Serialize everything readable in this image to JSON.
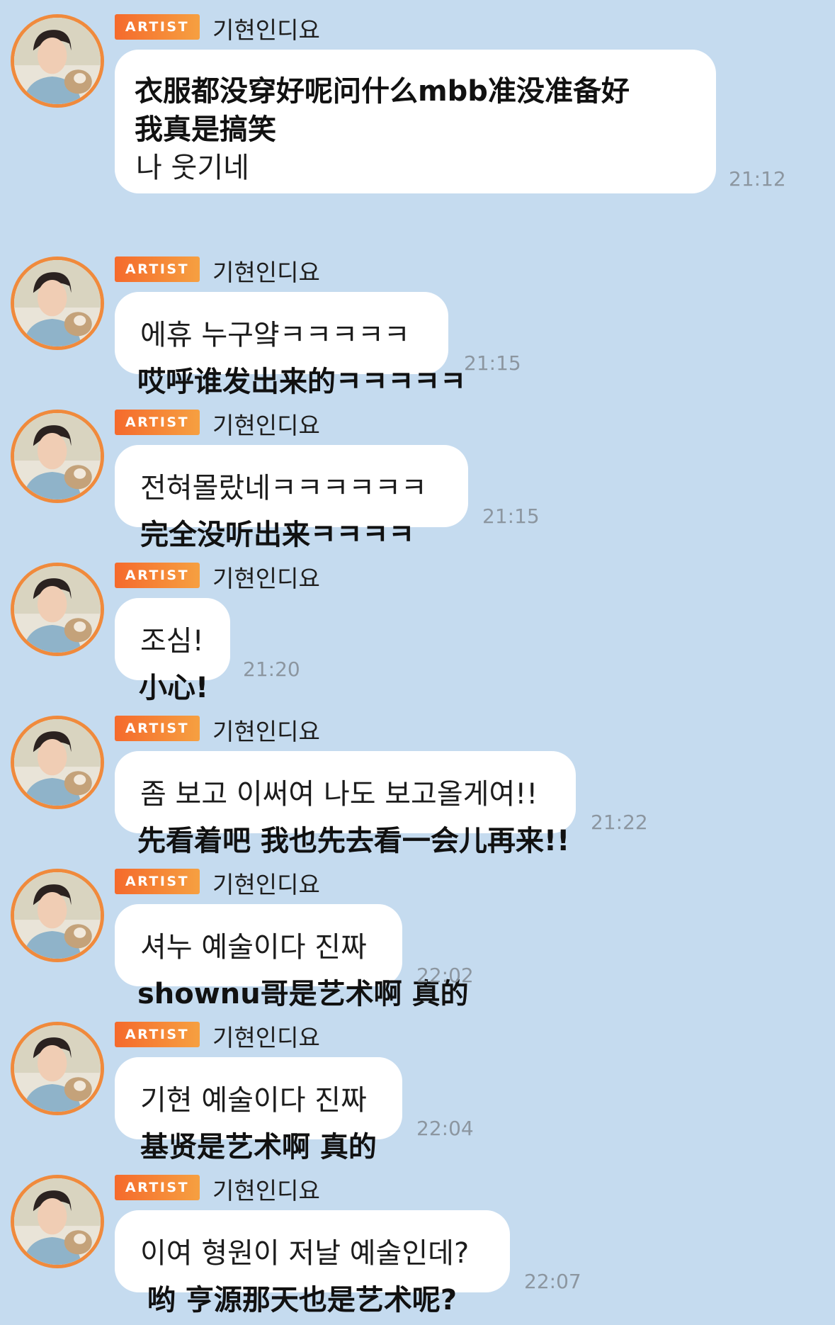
{
  "sender_badge": "ARTIST",
  "sender_name": "기현인디요",
  "messages": [
    {
      "cn1": "衣服都没穿好呢问什么mbb准没准备好",
      "cn2": "我真是搞笑",
      "kr": "나 웃기네",
      "time": "21:12"
    },
    {
      "kr": "에휴 누구얔ㅋㅋㅋㅋㅋ",
      "cn": "哎呼谁发出来的ㅋㅋㅋㅋㅋ",
      "time": "21:15"
    },
    {
      "kr": "전혀몰랐네ㅋㅋㅋㅋㅋㅋ",
      "cn": "完全没听出来ㅋㅋㅋㅋ",
      "time": "21:15"
    },
    {
      "kr": "조심!",
      "cn": "小心!",
      "time": "21:20"
    },
    {
      "kr": "좀 보고 이써여 나도 보고올게여!!",
      "cn": "先看着吧 我也先去看一会儿再来!!",
      "time": "21:22"
    },
    {
      "kr": "셔누 예술이다 진짜",
      "cn": "shownu哥是艺术啊 真的",
      "time": "22:02"
    },
    {
      "kr": "기현 예술이다 진짜",
      "cn": "基贤是艺术啊 真的",
      "time": "22:04"
    },
    {
      "kr": "이여 형원이 저날 예술인데?",
      "cn": "哟 亨源那天也是艺术呢?",
      "time": "22:07"
    }
  ]
}
